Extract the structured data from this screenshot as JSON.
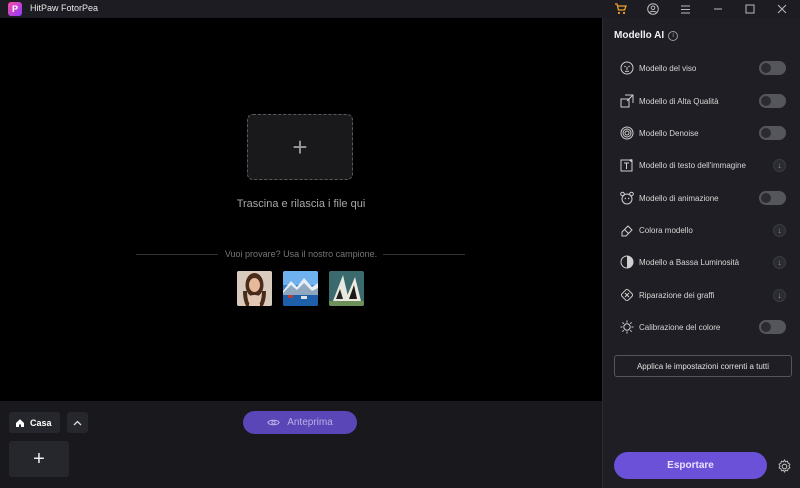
{
  "titlebar": {
    "app_title": "HitPaw FotorPea",
    "logo_letter": "P"
  },
  "canvas": {
    "drop_text": "Trascina e rilascia i file qui",
    "sample_text": "Vuoi provare? Usa il nostro campione."
  },
  "bottom": {
    "home_label": "Casa",
    "preview_label": "Anteprima"
  },
  "panel": {
    "title": "Modello AI",
    "models": [
      {
        "label": "Modello del viso",
        "control": "toggle",
        "icon": "face-icon"
      },
      {
        "label": "Modello di Alta Qualità",
        "control": "toggle",
        "icon": "upscale-icon"
      },
      {
        "label": "Modello Denoise",
        "control": "toggle",
        "icon": "denoise-icon"
      },
      {
        "label": "Modello di testo dell'immagine",
        "control": "download",
        "icon": "text-image-icon"
      },
      {
        "label": "Modello di animazione",
        "control": "toggle",
        "icon": "animation-icon"
      },
      {
        "label": "Colora modello",
        "control": "download",
        "icon": "colorize-icon"
      },
      {
        "label": "Modello a Bassa Luminosità",
        "control": "download",
        "icon": "low-light-icon"
      },
      {
        "label": "Riparazione dei graffi",
        "control": "download",
        "icon": "scratch-repair-icon"
      },
      {
        "label": "Calibrazione del colore",
        "control": "toggle",
        "icon": "color-calibration-icon"
      }
    ],
    "apply_label": "Applica le impostazioni correnti a tutti",
    "export_label": "Esportare"
  },
  "colors": {
    "accent": "#6a51d8",
    "preview": "#5b46b8",
    "panel_bg": "#1e1e24"
  }
}
